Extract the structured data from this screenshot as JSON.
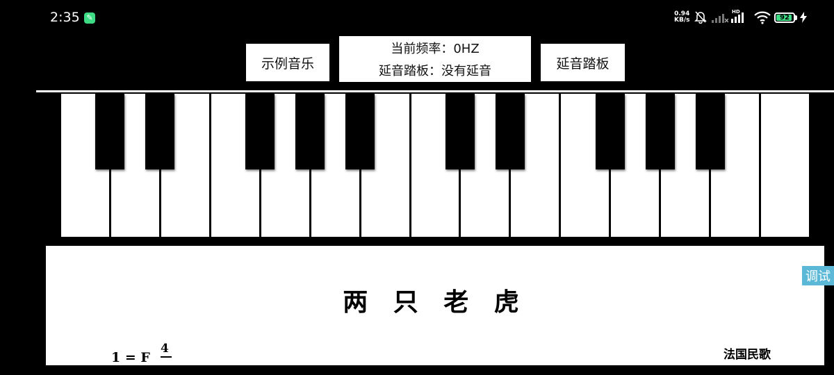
{
  "status_bar": {
    "time": "2:35",
    "net_speed_value": "0.94",
    "net_speed_unit": "KB/s",
    "hd_label": "HD",
    "battery_level": "92",
    "battery_fraction": 0.92
  },
  "controls": {
    "sample_music_label": "示例音乐",
    "sustain_pedal_label": "延音踏板",
    "current_frequency": "当前频率：0HZ",
    "pedal_status": "延音踏板：没有延音"
  },
  "sheet": {
    "title": "两 只 老 虎",
    "key_signature": "1 = F",
    "time_signature_top": "4",
    "composer": "法国民歌"
  },
  "debug": {
    "label": "调试"
  },
  "colors": {
    "accent_green": "#3ddc84",
    "debug_blue": "#5bb8d6"
  },
  "icons": {
    "app": "wrench-icon",
    "notifications": "bell-muted-icon",
    "wifi": "wifi-icon",
    "charging": "lightning-icon"
  }
}
